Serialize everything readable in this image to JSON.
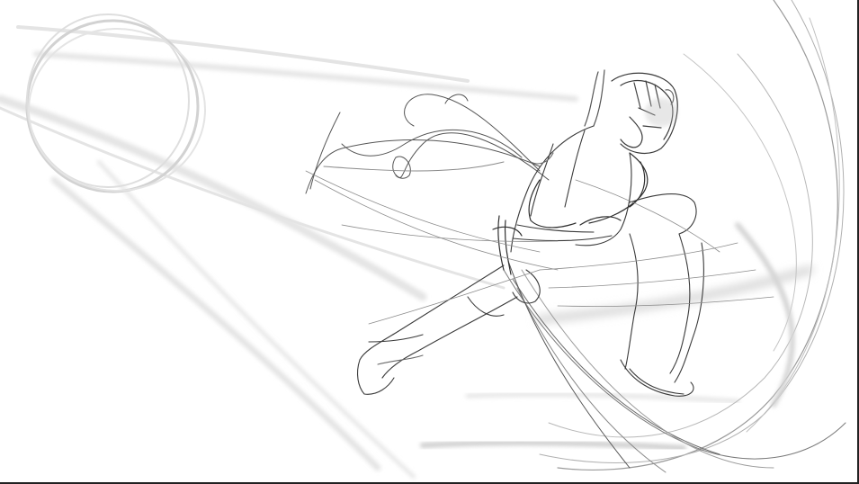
{
  "canvas": {
    "background": "#ffffff",
    "stroke_dark": "#2a2a2a",
    "stroke_mid": "#6e6e6e",
    "stroke_light": "#c8c8c8",
    "stroke_faint": "#e2e2e2",
    "frame_color": "#222222"
  },
  "sketch": {
    "subject": "figure-lunging-with-whip-sketch",
    "elements": [
      "ball-circle-icon",
      "figure-head",
      "figure-torso",
      "figure-arms",
      "figure-legs",
      "whip-lines",
      "motion-lines"
    ]
  }
}
